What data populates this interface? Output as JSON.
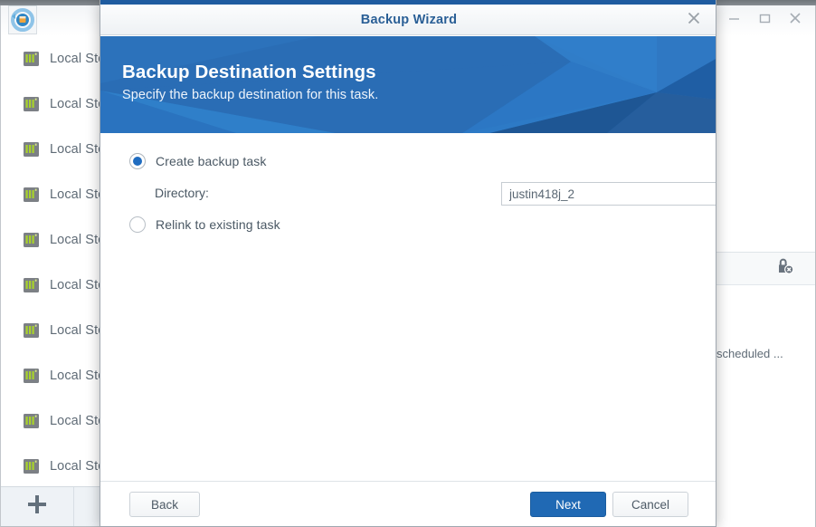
{
  "window": {
    "app_icon": "backup-restore-icon",
    "controls": [
      {
        "name": "minimize-button",
        "glyph": "minimize-icon"
      },
      {
        "name": "maximize-button",
        "glyph": "maximize-icon"
      },
      {
        "name": "close-button",
        "glyph": "close-icon"
      }
    ]
  },
  "sidebar": {
    "items": [
      {
        "icon": "storage-server-icon",
        "label": "Local Sto"
      },
      {
        "icon": "storage-server-icon",
        "label": "Local Sto"
      },
      {
        "icon": "storage-server-icon",
        "label": "Local Sto"
      },
      {
        "icon": "storage-server-icon",
        "label": "Local Sto"
      },
      {
        "icon": "storage-server-icon",
        "label": "Local Sto"
      },
      {
        "icon": "storage-server-icon",
        "label": "Local Sto"
      },
      {
        "icon": "storage-server-icon",
        "label": "Local Sto"
      },
      {
        "icon": "storage-server-icon",
        "label": "Local Sto"
      },
      {
        "icon": "storage-server-icon",
        "label": "Local Sto"
      },
      {
        "icon": "storage-server-icon",
        "label": "Local Sto"
      }
    ],
    "toolbar": {
      "add_label": "+",
      "add_icon": "plus-icon"
    }
  },
  "right_panel": {
    "header_icon": "lock-remove-icon",
    "row_text": "scheduled ..."
  },
  "dialog": {
    "title": "Backup Wizard",
    "close_icon": "close-icon",
    "banner": {
      "heading": "Backup Destination Settings",
      "subheading": "Specify the backup destination for this task.",
      "bg_color": "#2a6db5"
    },
    "options": [
      {
        "name": "create-backup-task",
        "label": "Create backup task",
        "selected": true
      },
      {
        "name": "relink-existing-task",
        "label": "Relink to existing task",
        "selected": false
      }
    ],
    "directory": {
      "label": "Directory:",
      "value": "justin418j_2",
      "placeholder": ""
    },
    "footer": {
      "back_label": "Back",
      "next_label": "Next",
      "cancel_label": "Cancel",
      "primary_color": "#2069b4"
    }
  }
}
